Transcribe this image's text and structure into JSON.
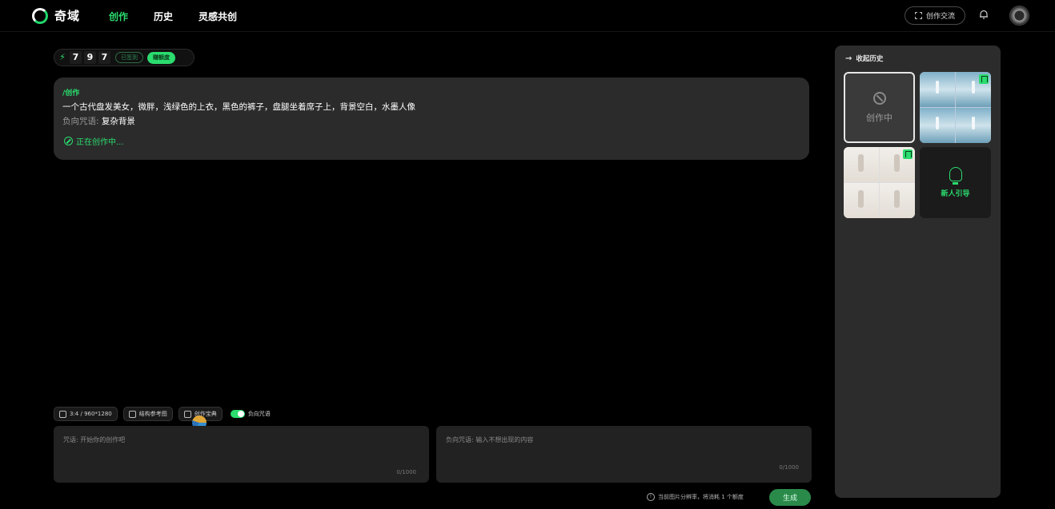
{
  "app": {
    "name": "奇域"
  },
  "nav": {
    "items": [
      "创作",
      "历史",
      "灵感共创"
    ],
    "active": 0
  },
  "header": {
    "exchange_label": "创作交流"
  },
  "credits": {
    "digits": [
      "7",
      "9",
      "7"
    ],
    "badge_ghost": "已签到",
    "badge_green": "赚额度"
  },
  "task": {
    "tag": "/创作",
    "prompt": "一个古代盘发美女，微胖，浅绿色的上衣，黑色的裤子，盘腿坐着席子上，背景空白，水墨人像",
    "negative_label": "负向咒语:",
    "negative_value": "复杂背景",
    "status": "正在创作中..."
  },
  "toolbar": {
    "ratio": "3:4 / 960*1280",
    "reference": "结构参考图",
    "dictionary": "创作宝典",
    "negative_toggle_label": "负向咒语",
    "negative_toggle_on": true
  },
  "inputs": {
    "prompt_placeholder": "咒语: 开始你的创作吧",
    "prompt_counter": "0/1000",
    "negative_placeholder": "负向咒语: 输入不想出现的内容",
    "negative_counter": "0/1000"
  },
  "footer": {
    "cost_note": "当前图片分辨率，将消耗 1 个额度",
    "generate_label": "生成"
  },
  "history": {
    "header": "收起历史",
    "creating_label": "创作中",
    "guide_label": "新人引导"
  },
  "colors": {
    "accent": "#2bdc6e",
    "panel": "#2c2c2c",
    "card": "#2b2b2b"
  }
}
